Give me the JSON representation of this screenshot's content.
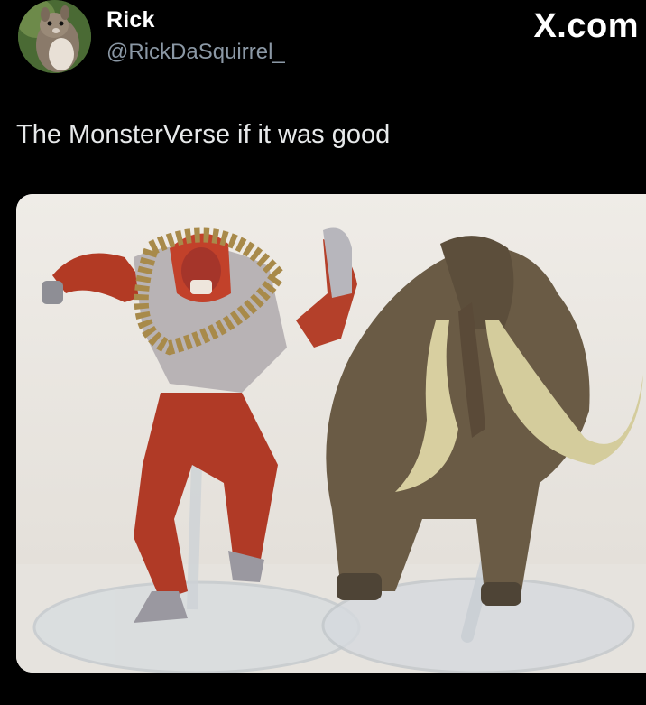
{
  "author": {
    "display_name": "Rick",
    "handle": "@RickDaSquirrel_"
  },
  "site_label": "X.com",
  "tweet": {
    "text": "The MonsterVerse if it was good"
  },
  "media": {
    "icon": "photo"
  }
}
